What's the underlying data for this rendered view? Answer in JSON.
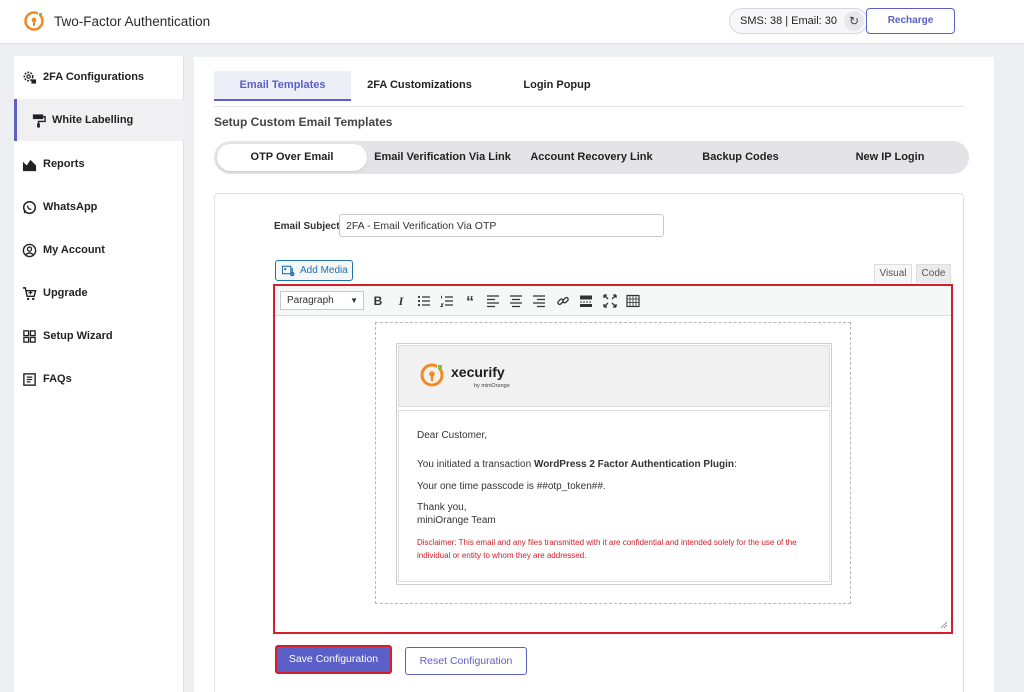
{
  "header": {
    "title": "Two-Factor Authentication",
    "credits": "SMS: 38 | Email: 30",
    "recharge_label": "Recharge"
  },
  "sidebar": {
    "items": [
      {
        "label": "2FA Configurations",
        "icon": "gear-lock-icon"
      },
      {
        "label": "White Labelling",
        "icon": "paint-roller-icon",
        "active": true
      },
      {
        "label": "Reports",
        "icon": "chart-icon"
      },
      {
        "label": "WhatsApp",
        "icon": "whatsapp-icon"
      },
      {
        "label": "My Account",
        "icon": "user-circle-icon"
      },
      {
        "label": "Upgrade",
        "icon": "cart-icon"
      },
      {
        "label": "Setup Wizard",
        "icon": "grid-icon"
      },
      {
        "label": "FAQs",
        "icon": "book-icon"
      }
    ]
  },
  "tabs": [
    {
      "label": "Email Templates",
      "active": true
    },
    {
      "label": "2FA Customizations"
    },
    {
      "label": "Login Popup"
    }
  ],
  "section_title": "Setup Custom Email Templates",
  "subtabs": [
    {
      "label": "OTP Over Email",
      "active": true
    },
    {
      "label": "Email Verification Via Link"
    },
    {
      "label": "Account Recovery Link"
    },
    {
      "label": "Backup Codes"
    },
    {
      "label": "New IP Login"
    }
  ],
  "form": {
    "subject_label": "Email Subject:",
    "subject_value": "2FA - Email Verification Via OTP",
    "add_media_label": "Add Media",
    "mode_visual": "Visual",
    "mode_code": "Code",
    "format_selected": "Paragraph"
  },
  "email": {
    "brand_name": "xecurify",
    "brand_sub": "by miniOrange",
    "greeting": "Dear Customer,",
    "line1_prefix": "You initiated a transaction ",
    "line1_bold": "WordPress 2 Factor Authentication Plugin",
    "line1_suffix": ":",
    "line2": "Your one time passcode is ##otp_token##.",
    "thanks": "Thank you,",
    "team": "miniOrange Team",
    "disclaimer": "Disclaimer: This email and any files transmitted with it are confidential and intended solely for the use of the individual or entity to whom they are addressed."
  },
  "actions": {
    "save_label": "Save Configuration",
    "reset_label": "Reset Configuration"
  },
  "colors": {
    "accent": "#5b5fc7",
    "highlight": "#d41f2a",
    "logo_orange": "#f08a24"
  }
}
